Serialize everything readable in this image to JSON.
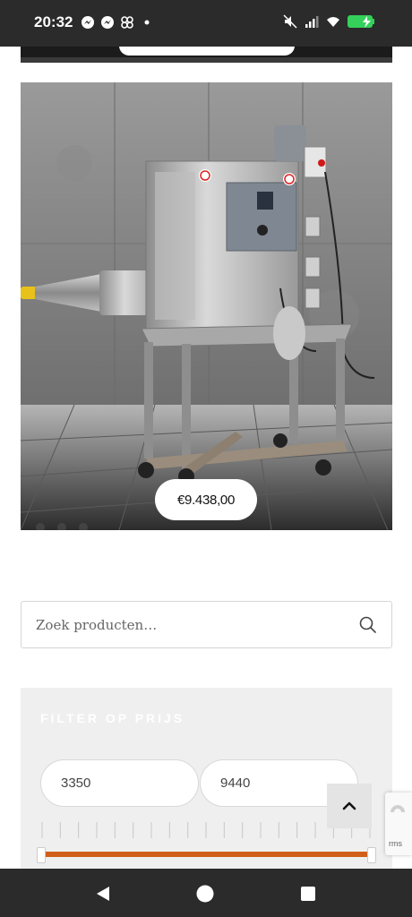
{
  "status_bar": {
    "time": "20:32",
    "left_icons": [
      "messenger-icon",
      "messenger-icon",
      "pinwheel-icon",
      "dot-icon"
    ],
    "right_icons": [
      "mute-icon",
      "signal-icon",
      "wifi-icon",
      "battery-charging-icon"
    ],
    "battery_color": "#35d05a"
  },
  "product": {
    "price": "€9.438,00",
    "image": "stainless-steel-machine-photo"
  },
  "search": {
    "placeholder": "Zoek producten…"
  },
  "filter": {
    "title": "FILTER OP PRIJS",
    "min_value": "3350",
    "max_value": "9440",
    "range_fraction": [
      0,
      1
    ],
    "accent_color": "#d05f1a"
  },
  "recaptcha": {
    "text": "rms"
  },
  "nav": {
    "buttons": [
      "back",
      "home",
      "recents"
    ]
  }
}
